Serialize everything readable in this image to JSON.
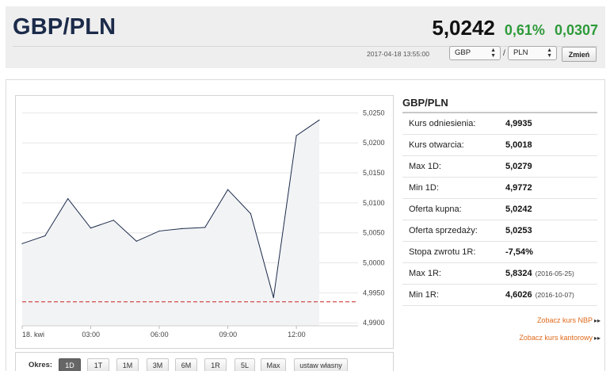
{
  "header": {
    "pair": "GBP/PLN",
    "price": "5,0242",
    "change_pct": "0,61%",
    "change_abs": "0,0307",
    "timestamp": "2017-04-18 13:55:00",
    "from_currency": "GBP",
    "to_currency": "PLN",
    "separator": "/",
    "change_button": "Zmień"
  },
  "colors": {
    "positive": "#2e9a3a",
    "line": "#1c2b4a",
    "reference": "#cc2222",
    "link": "#e06a1b"
  },
  "chart_data": {
    "type": "area",
    "x_ticks": [
      "18. kwi",
      "03:00",
      "06:00",
      "09:00",
      "12:00"
    ],
    "y_ticks": [
      "5,0250",
      "5,0200",
      "5,0150",
      "5,0100",
      "5,0050",
      "5,0000",
      "4,9950",
      "4,9900"
    ],
    "ylim": [
      4.9895,
      5.0265
    ],
    "x_hours": [
      0,
      1,
      2,
      3,
      4,
      5,
      6,
      7,
      8,
      9,
      10,
      11,
      12,
      13
    ],
    "values": [
      5.0032,
      5.0045,
      5.0107,
      5.0058,
      5.0071,
      5.0036,
      5.0053,
      5.0057,
      5.0059,
      5.0122,
      5.0082,
      4.9942,
      5.0212,
      5.0238
    ],
    "xlim": [
      0,
      14.7
    ],
    "reference_value": 4.9935
  },
  "periods": {
    "label": "Okres:",
    "items": [
      "1D",
      "1T",
      "1M",
      "3M",
      "6M",
      "1R",
      "5L",
      "Max",
      "ustaw własny"
    ],
    "active": "1D"
  },
  "stats": {
    "title": "GBP/PLN",
    "rows": [
      {
        "label": "Kurs odniesienia:",
        "value": "4,9935",
        "date": ""
      },
      {
        "label": "Kurs otwarcia:",
        "value": "5,0018",
        "date": ""
      },
      {
        "label": "Max 1D:",
        "value": "5,0279",
        "date": ""
      },
      {
        "label": "Min 1D:",
        "value": "4,9772",
        "date": ""
      },
      {
        "label": "Oferta kupna:",
        "value": "5,0242",
        "date": ""
      },
      {
        "label": "Oferta sprzedaży:",
        "value": "5,0253",
        "date": ""
      },
      {
        "label": "Stopa zwrotu 1R:",
        "value": "-7,54%",
        "date": ""
      },
      {
        "label": "Max 1R:",
        "value": "5,8324",
        "date": "(2016-05-25)"
      },
      {
        "label": "Min 1R:",
        "value": "4,6026",
        "date": "(2016-10-07)"
      }
    ]
  },
  "links": {
    "nbp": "Zobacz kurs NBP",
    "kantor": "Zobacz kurs kantorowy",
    "arrow": "▸▸"
  }
}
